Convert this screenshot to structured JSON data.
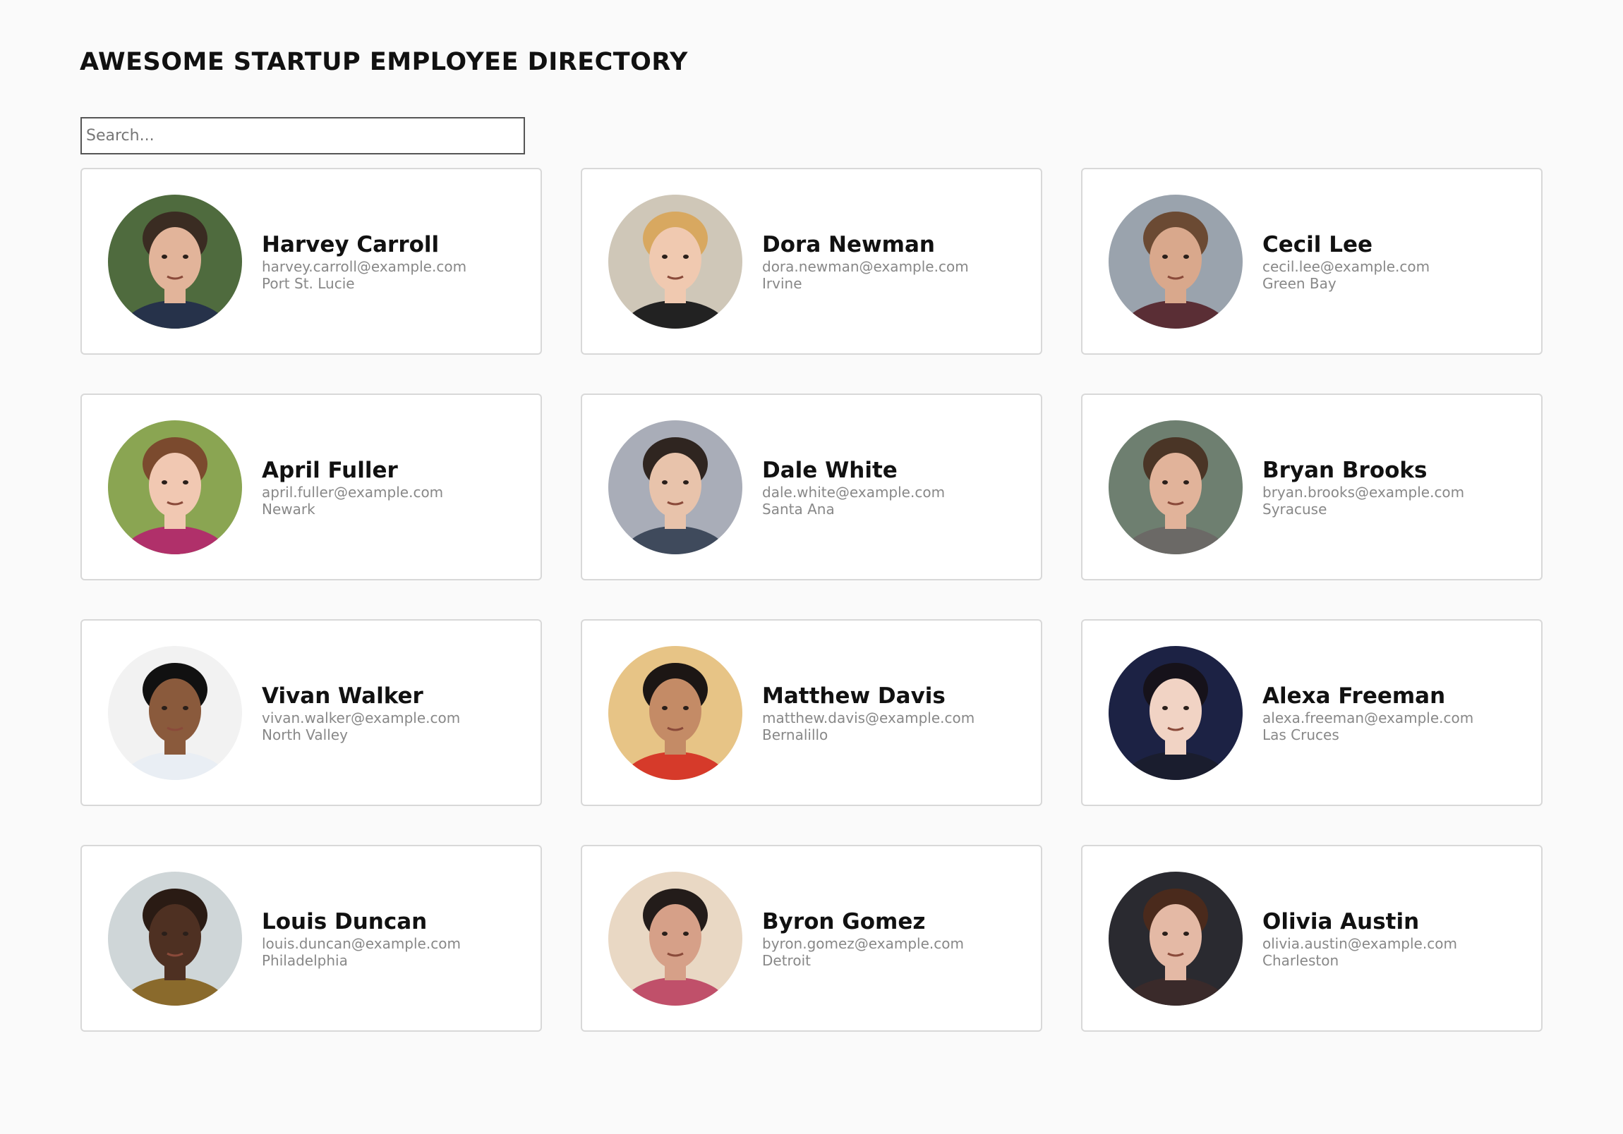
{
  "header": {
    "title": "AWESOME STARTUP EMPLOYEE DIRECTORY"
  },
  "search": {
    "placeholder": "Search...",
    "value": ""
  },
  "employees": [
    {
      "name": "Harvey Carroll",
      "email": "harvey.carroll@example.com",
      "city": "Port St. Lucie",
      "bg": "#4f6b3e",
      "skin": "#e2b49a",
      "hair": "#3a2c22",
      "shirt": "#26324a"
    },
    {
      "name": "Dora Newman",
      "email": "dora.newman@example.com",
      "city": "Irvine",
      "bg": "#cfc7b8",
      "skin": "#f0c9b0",
      "hair": "#d8a860",
      "shirt": "#222222"
    },
    {
      "name": "Cecil Lee",
      "email": "cecil.lee@example.com",
      "city": "Green Bay",
      "bg": "#9aa3ad",
      "skin": "#d9a88c",
      "hair": "#6b4a33",
      "shirt": "#5a2e35"
    },
    {
      "name": "April Fuller",
      "email": "april.fuller@example.com",
      "city": "Newark",
      "bg": "#8aa552",
      "skin": "#f1c8b2",
      "hair": "#7b4a2e",
      "shirt": "#b0306a"
    },
    {
      "name": "Dale White",
      "email": "dale.white@example.com",
      "city": "Santa Ana",
      "bg": "#a9adb8",
      "skin": "#e8c3ab",
      "hair": "#2f2520",
      "shirt": "#3f4a5c"
    },
    {
      "name": "Bryan Brooks",
      "email": "bryan.brooks@example.com",
      "city": "Syracuse",
      "bg": "#6e7f70",
      "skin": "#e1b39a",
      "hair": "#4a3526",
      "shirt": "#6b6966"
    },
    {
      "name": "Vivan Walker",
      "email": "vivan.walker@example.com",
      "city": "North Valley",
      "bg": "#f2f2f2",
      "skin": "#8a5a3c",
      "hair": "#111111",
      "shirt": "#e9eef4"
    },
    {
      "name": "Matthew Davis",
      "email": "matthew.davis@example.com",
      "city": "Bernalillo",
      "bg": "#e7c486",
      "skin": "#c48b66",
      "hair": "#1c1614",
      "shirt": "#d63a2a"
    },
    {
      "name": "Alexa Freeman",
      "email": "alexa.freeman@example.com",
      "city": "Las Cruces",
      "bg": "#1c2244",
      "skin": "#f1d3c4",
      "hair": "#16121a",
      "shirt": "#1a1d2e"
    },
    {
      "name": "Louis Duncan",
      "email": "louis.duncan@example.com",
      "city": "Philadelphia",
      "bg": "#cfd6d8",
      "skin": "#4e3022",
      "hair": "#2a1b14",
      "shirt": "#8a6a2c"
    },
    {
      "name": "Byron Gomez",
      "email": "byron.gomez@example.com",
      "city": "Detroit",
      "bg": "#e9d8c4",
      "skin": "#d6a088",
      "hair": "#231c1a",
      "shirt": "#c0506a"
    },
    {
      "name": "Olivia Austin",
      "email": "olivia.austin@example.com",
      "city": "Charleston",
      "bg": "#2a2a30",
      "skin": "#e4b9a5",
      "hair": "#4a2a1c",
      "shirt": "#3a2a2a"
    }
  ]
}
